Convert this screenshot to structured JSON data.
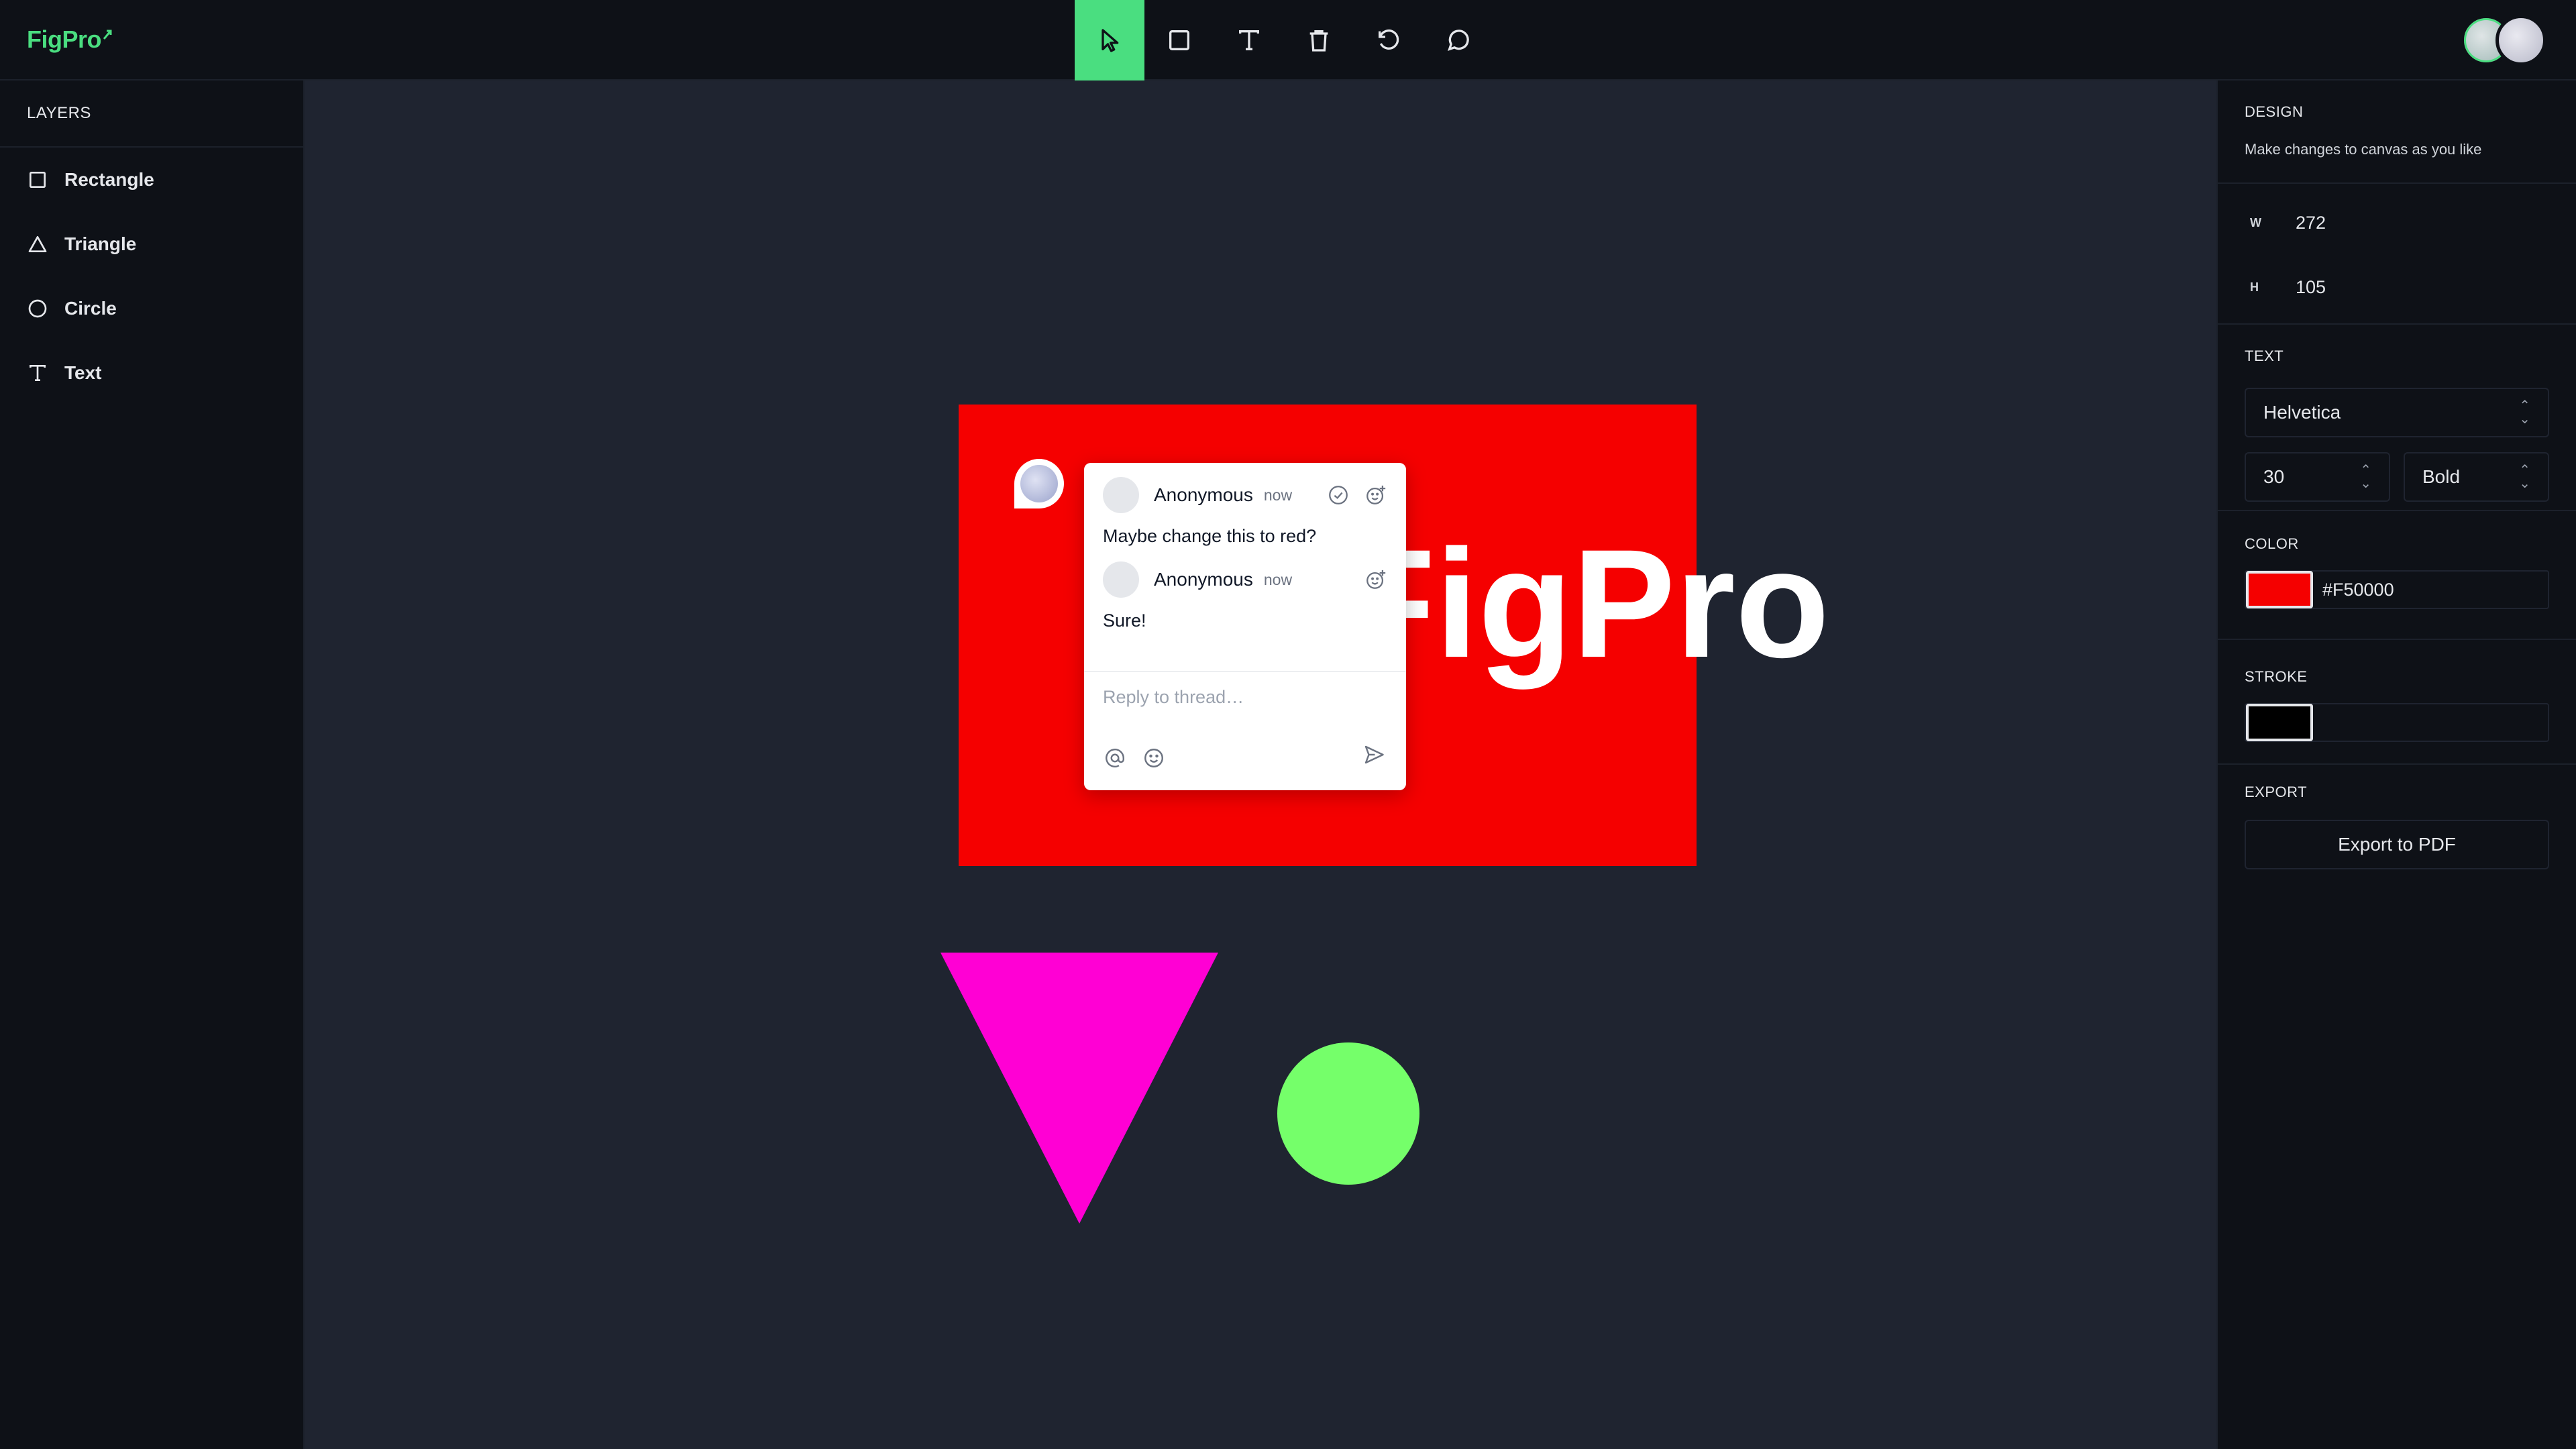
{
  "app": {
    "logo_text": "FigPro"
  },
  "toolbar": {
    "tools": [
      {
        "name": "select",
        "icon": "cursor-icon",
        "active": true
      },
      {
        "name": "rectangle",
        "icon": "square-icon"
      },
      {
        "name": "text",
        "icon": "text-icon"
      },
      {
        "name": "delete",
        "icon": "trash-icon"
      },
      {
        "name": "reset",
        "icon": "rotate-icon"
      },
      {
        "name": "comments",
        "icon": "comment-icon"
      }
    ],
    "accent_color": "#4ADE80"
  },
  "layers": {
    "title": "LAYERS",
    "items": [
      {
        "label": "Rectangle",
        "icon": "square-icon"
      },
      {
        "label": "Triangle",
        "icon": "triangle-icon"
      },
      {
        "label": "Circle",
        "icon": "circle-icon"
      },
      {
        "label": "Text",
        "icon": "text-icon"
      }
    ]
  },
  "design": {
    "title": "DESIGN",
    "subtitle": "Make changes to canvas as you like",
    "width_label": "W",
    "width_value": "272",
    "height_label": "H",
    "height_value": "105",
    "text_title": "TEXT",
    "font_family": "Helvetica",
    "font_size": "30",
    "font_weight": "Bold",
    "color_title": "COLOR",
    "color_value": "#F50000",
    "stroke_title": "STROKE",
    "stroke_color": "#000000",
    "export_title": "EXPORT",
    "export_label": "Export to PDF"
  },
  "canvas": {
    "background": "#1F2430",
    "rectangle_color": "#F50000",
    "text_content": "FigPro",
    "triangle_color": "#FF00D4",
    "circle_color": "#75FF6A"
  },
  "comment_thread": {
    "messages": [
      {
        "author": "Anonymous",
        "time": "now",
        "body": "Maybe change this to red?"
      },
      {
        "author": "Anonymous",
        "time": "now",
        "body": "Sure!"
      }
    ],
    "reply_placeholder": "Reply to thread…"
  }
}
